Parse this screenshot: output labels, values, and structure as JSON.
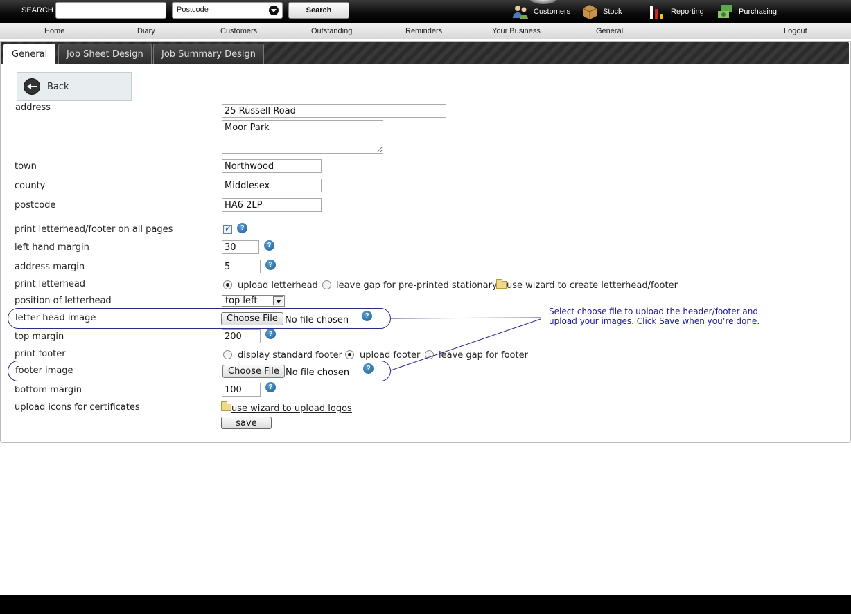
{
  "topbar": {
    "search_label": "SEARCH",
    "search_value": "",
    "search_type": "Postcode",
    "search_button": "Search",
    "links": {
      "customers": "Customers",
      "stock": "Stock",
      "reporting": "Reporting",
      "purchasing": "Purchasing"
    }
  },
  "nav": {
    "home": "Home",
    "diary": "Diary",
    "customers": "Customers",
    "outstanding": "Outstanding",
    "reminders": "Reminders",
    "your_business": "Your Business",
    "general": "General",
    "logout": "Logout"
  },
  "tabs": {
    "general": "General",
    "job_sheet": "Job Sheet Design",
    "job_summary": "Job Summary Design"
  },
  "back_label": "Back",
  "form": {
    "address_label": "address",
    "address_line1": "25 Russell Road",
    "address_line2": "Moor Park",
    "town_label": "town",
    "town": "Northwood",
    "county_label": "county",
    "county": "Middlesex",
    "postcode_label": "postcode",
    "postcode": "HA6 2LP",
    "print_all_label": "print letterhead/footer on all pages",
    "left_margin_label": "left hand margin",
    "left_margin": "30",
    "address_margin_label": "address margin",
    "address_margin": "5",
    "print_letterhead_label": "print letterhead",
    "upload_letterhead": "upload letterhead",
    "leave_gap_stationary": "leave gap for pre-printed stationary",
    "wizard_letterhead": " use wizard to create letterhead/footer",
    "position_label": "position of letterhead",
    "position_value": "top left",
    "letterhead_image_label": "letter head image",
    "choose_file": "Choose File",
    "no_file": "No file chosen",
    "top_margin_label": "top margin",
    "top_margin": "200",
    "print_footer_label": "print footer",
    "display_standard_footer": "display standard footer",
    "upload_footer": "upload footer",
    "leave_gap_footer": "leave gap for footer",
    "footer_image_label": "footer image",
    "bottom_margin_label": "bottom margin",
    "bottom_margin": "100",
    "upload_icons_label": "upload icons for certificates",
    "wizard_logos": " use wizard to upload logos",
    "save": "save"
  },
  "callout": "Select choose file to upload the header/footer and upload your images.  Click Save when you’re done."
}
